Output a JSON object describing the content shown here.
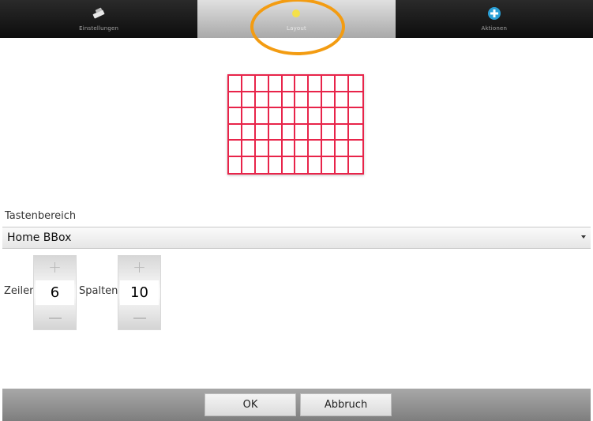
{
  "tabs": [
    {
      "label": "Einstellungen",
      "icon": "tools-icon",
      "selected": false
    },
    {
      "label": "Layout",
      "icon": "star-icon",
      "selected": true
    },
    {
      "label": "Aktionen",
      "icon": "plus-circle-icon",
      "selected": false
    }
  ],
  "grid": {
    "rows": 6,
    "columns": 10,
    "color": "#e8244a"
  },
  "key_area": {
    "label": "Tastenbereich",
    "selected": "Home BBox"
  },
  "rows_stepper": {
    "label": "Zeilen",
    "value": "6",
    "plus": "+"
  },
  "columns_stepper": {
    "label": "Spalten",
    "value": "10",
    "plus": "+"
  },
  "buttons": {
    "ok": "OK",
    "cancel": "Abbruch"
  },
  "highlight_color": "#f39c12"
}
